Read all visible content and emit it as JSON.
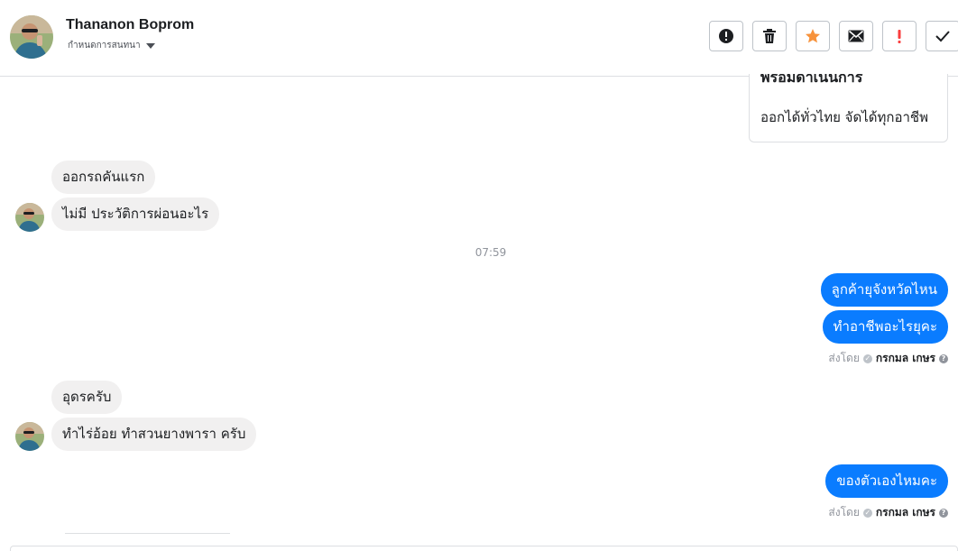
{
  "header": {
    "contact_name": "Thananon Boprom",
    "assign_label": "กำหนดการสนทนา",
    "actions": [
      {
        "name": "spam-button",
        "icon": "exclamation-circle-icon"
      },
      {
        "name": "delete-button",
        "icon": "trash-icon"
      },
      {
        "name": "star-button",
        "icon": "star-icon",
        "color": "#f7923b"
      },
      {
        "name": "mark-unread-button",
        "icon": "envelope-icon"
      },
      {
        "name": "follow-up-button",
        "icon": "exclamation-icon",
        "color": "#fa3e3e"
      },
      {
        "name": "mark-done-button",
        "icon": "checkmark-icon"
      }
    ]
  },
  "info_card": {
    "heading_cut": "พร้อมดำเนินการ",
    "body": "ออกได้ทั่วไทย จัดได้ทุกอาชีพ"
  },
  "messages": {
    "in_1a": "ออกรถคันแรก",
    "in_1b": "ไม่มี ประวัติการผ่อนอะไร",
    "timestamp": "07:59",
    "out_1a": "ลูกค้ายุจังหวัดไหน",
    "out_1b": "ทำอาชีพอะไรยุคะ",
    "in_2a": "อุดรครับ",
    "in_2b": "ทำไร่อ้อย ทำสวนยางพารา ครับ",
    "out_2": "ของตัวเองไหมคะ"
  },
  "sent_by": {
    "label": "ส่งโดย",
    "agent": "กรกมล เกษร"
  },
  "colors": {
    "outgoing_bubble": "#0a7cff",
    "incoming_bubble": "#f1f0f0",
    "star": "#f7923b",
    "follow_up": "#fa3e3e"
  }
}
